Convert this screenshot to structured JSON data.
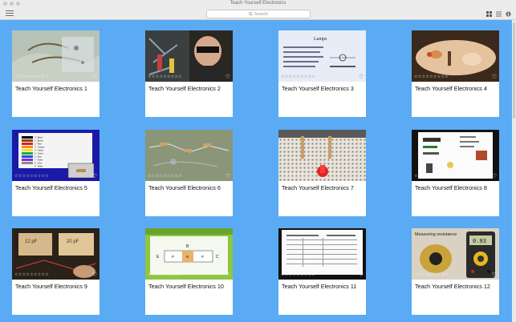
{
  "window": {
    "title": "Teach Yourself Electronics"
  },
  "toolbar": {
    "search_placeholder": "Search"
  },
  "rating": {
    "stars": "☆☆☆☆☆☆☆☆☆",
    "heart": "♡"
  },
  "cards": [
    {
      "title": "Teach Yourself Electronics 1"
    },
    {
      "title": "Teach Yourself Electronics 2"
    },
    {
      "title": "Teach Yourself Electronics 3"
    },
    {
      "title": "Teach Yourself Electronics 4"
    },
    {
      "title": "Teach Yourself Electronics 5"
    },
    {
      "title": "Teach Yourself Electronics 6"
    },
    {
      "title": "Teach Yourself Electronics 7"
    },
    {
      "title": "Teach Yourself Electronics 8"
    },
    {
      "title": "Teach Yourself Electronics 9"
    },
    {
      "title": "Teach Yourself Electronics 10"
    },
    {
      "title": "Teach Yourself Electronics 11"
    },
    {
      "title": "Teach Yourself Electronics 12"
    }
  ],
  "thumb_text": {
    "card3_heading": "Lamps",
    "card5_colors": [
      "0 - Black",
      "1 - Brown",
      "2 - Red",
      "3 - Orange",
      "4 - Yellow",
      "5 - Green",
      "6 - Blue",
      "7 - Violet",
      "8 - Grey",
      "9 - White"
    ],
    "card9_left": "12 pF",
    "card9_right": "20 pF",
    "card10_b": "B",
    "card10_e": "E",
    "card10_c": "C",
    "card10_p1": "P",
    "card10_n": "N",
    "card10_p2": "P",
    "card12_heading": "Measuring resistance",
    "card12_display": "0.93"
  }
}
